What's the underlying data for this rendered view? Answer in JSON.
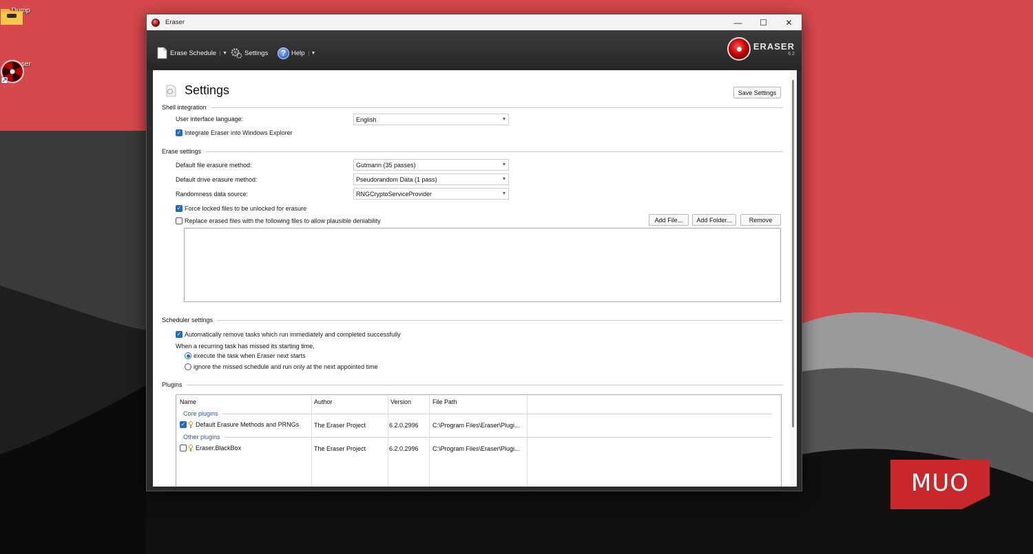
{
  "desktop": {
    "icons": [
      {
        "label": "Dump",
        "icon": "folder-icon"
      },
      {
        "label": "Eraser",
        "icon": "eraser-app-icon"
      }
    ],
    "watermark": "MUO"
  },
  "window": {
    "title": "Eraser",
    "controls": {
      "minimize": "—",
      "maximize": "☐",
      "close": "✕"
    },
    "toolbar": {
      "erase_schedule": "Erase Schedule",
      "settings": "Settings",
      "help": "Help",
      "brand": "ERASER",
      "brand_version": "6.2"
    }
  },
  "settings": {
    "title": "Settings",
    "save_button": "Save Settings",
    "shell": {
      "header": "Shell integration",
      "language_label": "User interface language:",
      "language_value": "English",
      "integrate_label": "Integrate Eraser into Windows Explorer",
      "integrate_checked": true
    },
    "erase": {
      "header": "Erase settings",
      "file_method_label": "Default file erasure method:",
      "file_method_value": "Gutmann (35 passes)",
      "drive_method_label": "Default drive erasure method:",
      "drive_method_value": "Pseudorandom Data (1 pass)",
      "random_label": "Randomness data source:",
      "random_value": "RNGCryptoServiceProvider",
      "force_unlock_label": "Force locked files to be unlocked for erasure",
      "force_unlock_checked": true,
      "replace_label": "Replace erased files with the following files to allow plausible deniability",
      "replace_checked": false,
      "add_file": "Add File...",
      "add_folder": "Add Folder...",
      "remove": "Remove"
    },
    "scheduler": {
      "header": "Scheduler settings",
      "auto_remove_label": "Automatically remove tasks which run immediately and completed successfully",
      "auto_remove_checked": true,
      "missed_label": "When a recurring task has missed its starting time,",
      "option_execute": "execute the task when Eraser next starts",
      "option_ignore": "ignore the missed schedule and run only at the next appointed time",
      "selected": "execute"
    },
    "plugins": {
      "header": "Plugins",
      "columns": [
        "Name",
        "Author",
        "Version",
        "File Path"
      ],
      "groups": [
        {
          "name": "Core plugins",
          "rows": [
            {
              "checked": true,
              "name": "Default Erasure Methods and PRNGs",
              "author": "The Eraser Project",
              "version": "6.2.0.2996",
              "path": "C:\\Program Files\\Eraser\\Plugi..."
            }
          ]
        },
        {
          "name": "Other plugins",
          "rows": [
            {
              "checked": false,
              "name": "Eraser.BlackBox",
              "author": "The Eraser Project",
              "version": "6.2.0.2996",
              "path": "C:\\Program Files\\Eraser\\Plugi..."
            }
          ]
        }
      ]
    }
  }
}
